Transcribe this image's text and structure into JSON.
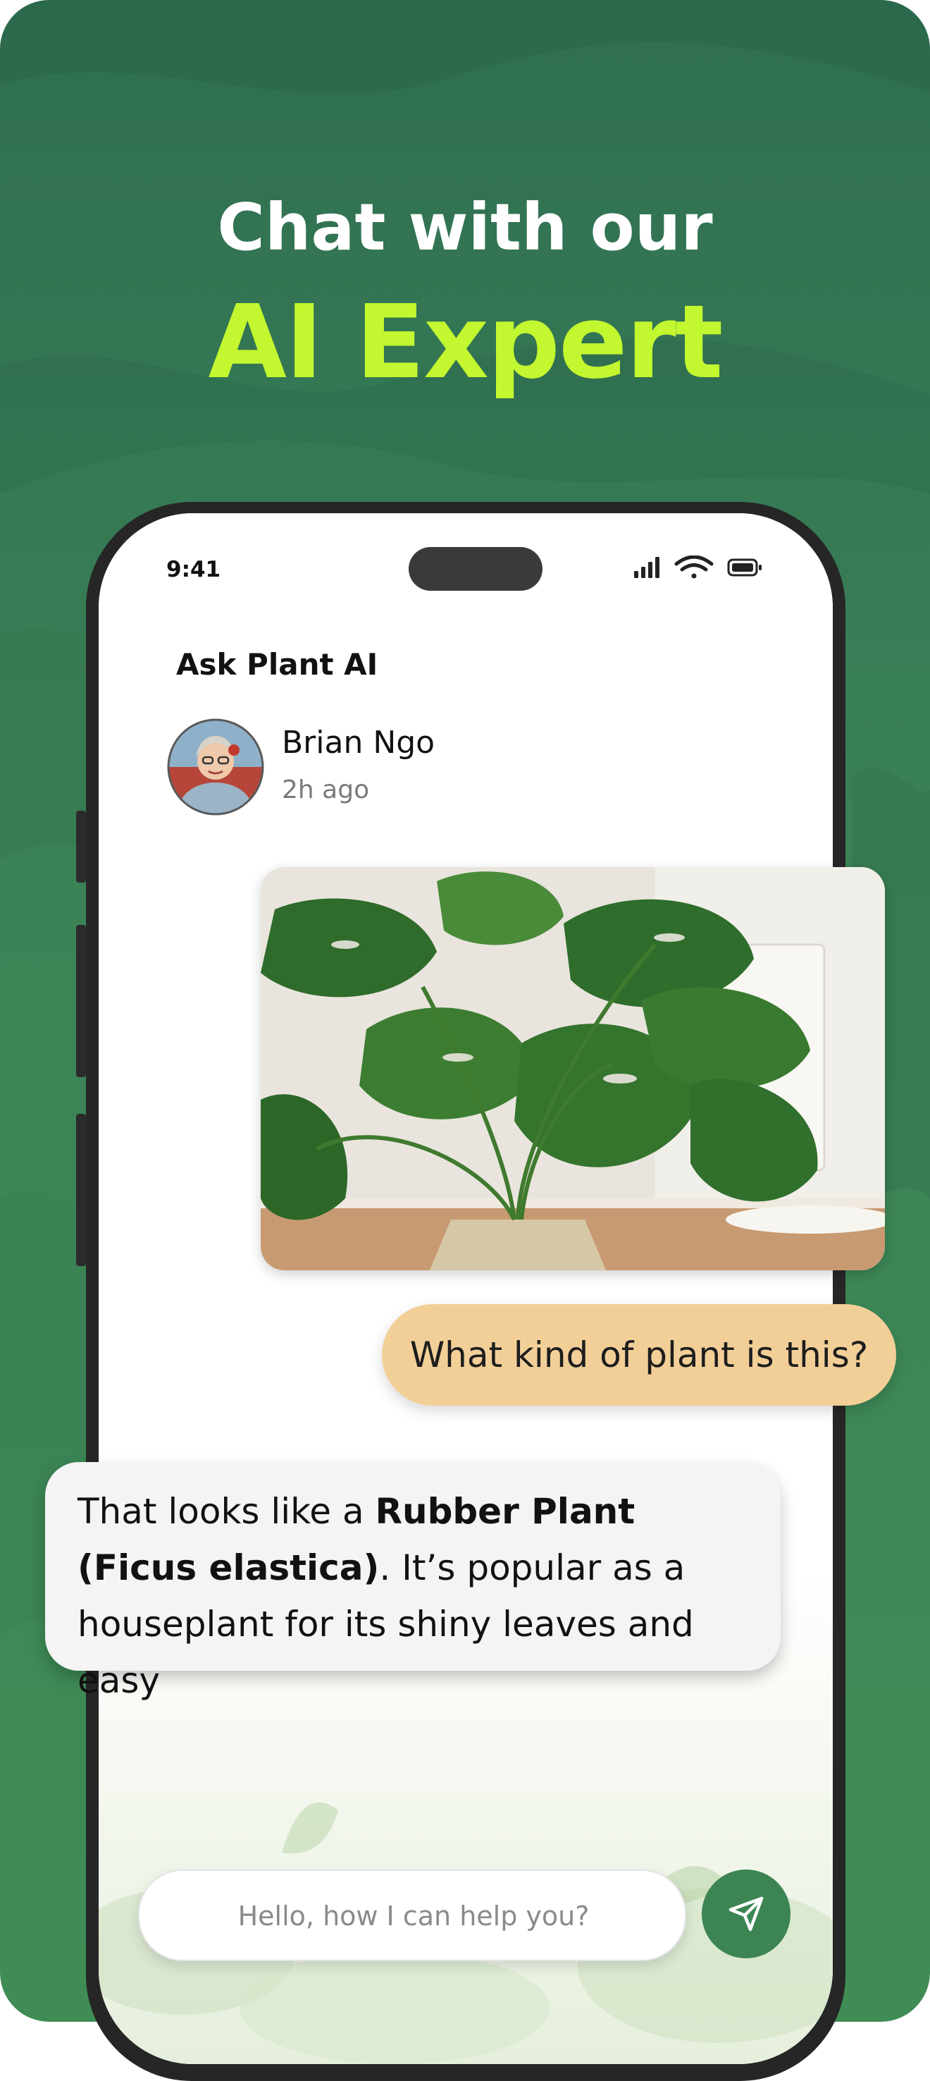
{
  "headline": {
    "line1": "Chat with our",
    "line2": "AI Expert"
  },
  "colors": {
    "background_green": "#3b8356",
    "headline_accent": "#c3f72f",
    "question_bubble": "#f3cf98",
    "send_button": "#3c8553"
  },
  "status_bar": {
    "time": "9:41",
    "icons": [
      "signal-icon",
      "wifi-icon",
      "battery-icon"
    ]
  },
  "chat": {
    "title": "Ask Plant AI",
    "user": {
      "name": "Brian Ngo",
      "time": "2h ago"
    },
    "messages": {
      "question": "What kind of plant is this?",
      "answer": {
        "prefix": "That looks like a ",
        "highlight": "Rubber Plant (Ficus elastica)",
        "suffix": ". It’s popular as a houseplant for its shiny leaves and easy"
      }
    }
  },
  "composer": {
    "placeholder": "Hello, how I can help you?",
    "send_icon": "send-icon"
  }
}
